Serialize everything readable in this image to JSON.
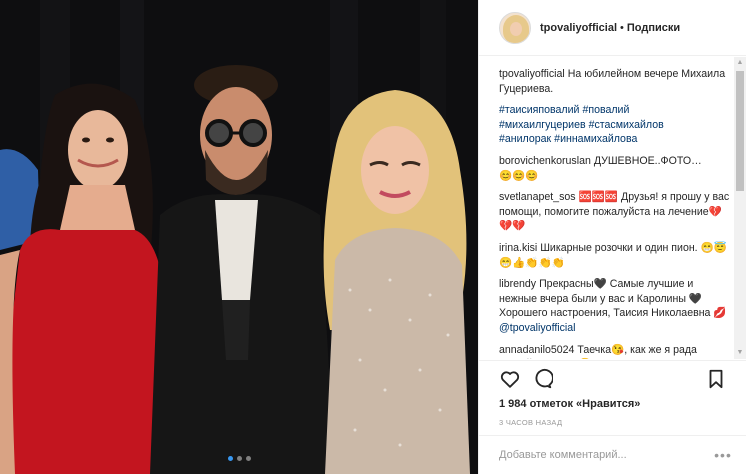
{
  "post": {
    "photo_alt": "Four people posing at an event",
    "carousel_dots": 3
  },
  "header": {
    "username": "tpovaliyofficial",
    "separator": "•",
    "follow_label": "Подписки"
  },
  "caption": {
    "username": "tpovaliyofficial",
    "text": "На юбилейном вечере Михаила Гуцериева.",
    "hashtags": [
      "#таисияповалий",
      "#повалий",
      "#михаилгуцериев",
      "#стасмихайлов",
      "#анилорак",
      "#иннамихайлова"
    ]
  },
  "comments": [
    {
      "username": "borovichenkoruslan",
      "text": "ДУШЕВНОЕ..ФОТО…",
      "emoji": "😊😊😊"
    },
    {
      "username": "svetlanapet_sos",
      "text": "🆘🆘🆘 Друзья! я прошу у вас помощи, помогите пожалуйста на лечение💔💔💔",
      "emoji": ""
    },
    {
      "username": "irina.kisi",
      "text": "Шикарные розочки и один пион.",
      "emoji": "😁😇😁👍👏👏👏"
    },
    {
      "username": "librendy",
      "text": "Прекрасны🖤 Самые лучшие и нежные вчера были у вас и Каролины 🖤 Хорошего настроения, Таисия Николаевна 💋",
      "mention": "@tpovaliyofficial"
    },
    {
      "username": "annadanilo5024",
      "text": "Таечка😘, как же я рада Вашей весточке😘!!! Солнышко",
      "emoji": ""
    }
  ],
  "likes": "1 984 отметок «Нравится»",
  "timestamp": "3 ЧАСОВ НАЗАД",
  "comment_input": {
    "placeholder": "Добавьте комментарий..."
  },
  "colors": {
    "link": "#003569",
    "border": "#efefef",
    "muted": "#999999",
    "active_dot": "#3897f0"
  }
}
